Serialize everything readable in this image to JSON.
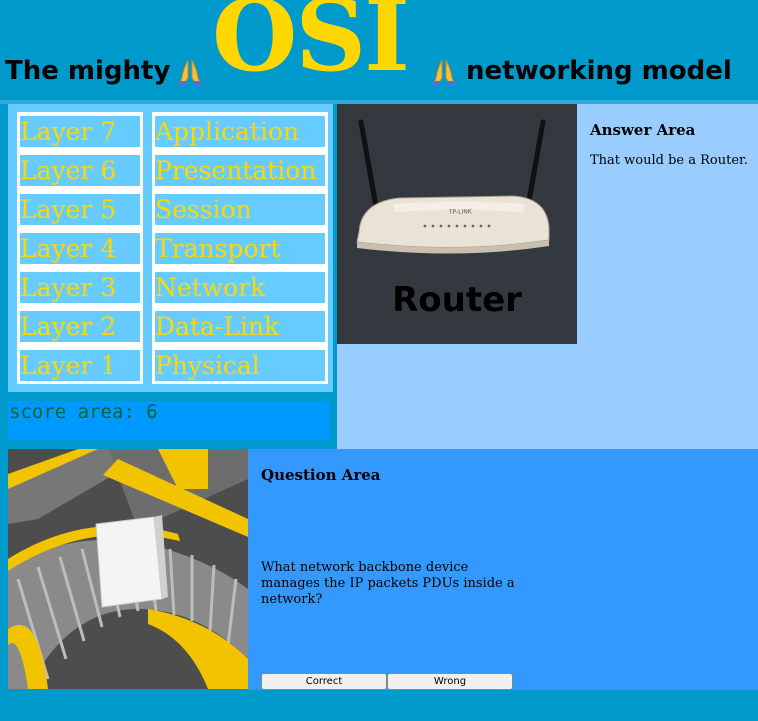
{
  "header": {
    "title_left": "The mighty",
    "title_osi": "OSI",
    "title_right": "networking model",
    "icon_left": "folded-hands-emoji",
    "icon_right": "folded-hands-emoji"
  },
  "layers": {
    "numbers": [
      "Layer 7",
      "Layer 6",
      "Layer 5",
      "Layer 4",
      "Layer 3",
      "Layer 2",
      "Layer 1"
    ],
    "names": [
      "Application",
      "Presentation",
      "Session",
      "Transport",
      "Network",
      "Data-Link",
      "Physical"
    ]
  },
  "score": {
    "text": "score area: 6"
  },
  "answer": {
    "title": "Answer Area",
    "text": "That would be a Router.",
    "image_caption": "Router",
    "image_brand": "TP-LINK"
  },
  "question": {
    "title": "Question Area",
    "text": "What network backbone device manages the IP packets PDUs inside a network?",
    "correct_label": "Correct",
    "wrong_label": "Wrong"
  },
  "colors": {
    "background": "#0099cc",
    "osi_gold": "#ffd700",
    "layer_cell": "#66ccff",
    "score_bg": "#0099ff",
    "answer_bg": "#99ccff",
    "question_bg": "#3399ff"
  }
}
